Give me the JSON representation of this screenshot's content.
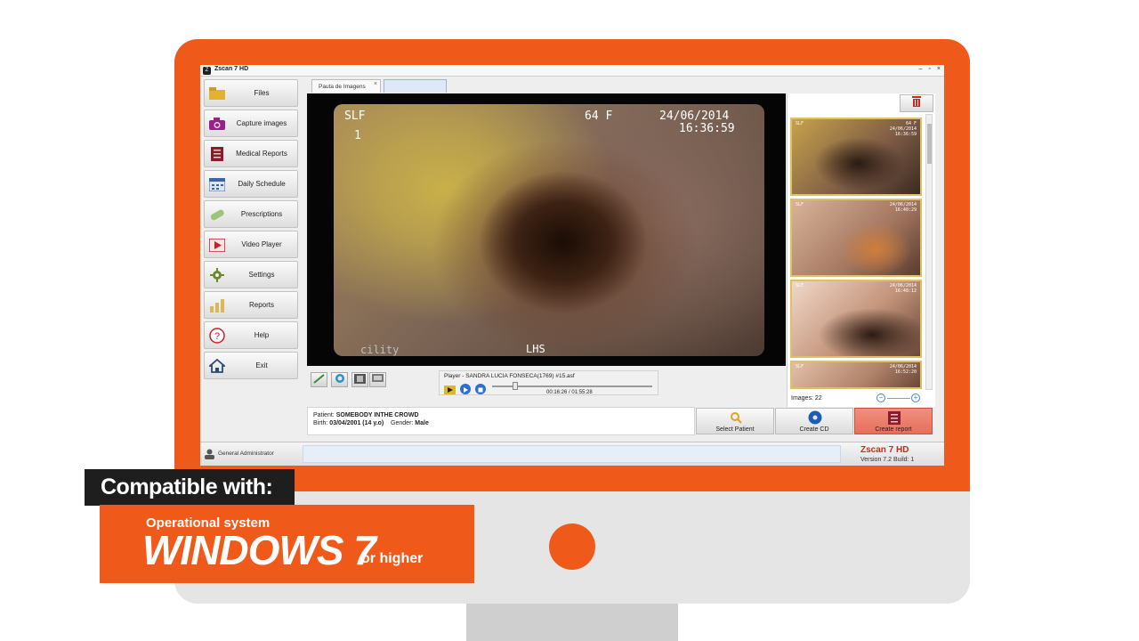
{
  "app": {
    "title": "Zscan 7 HD",
    "window_controls": [
      "–",
      "▫",
      "×"
    ]
  },
  "sidebar": {
    "items": [
      {
        "label": "Files",
        "icon": "folder-icon"
      },
      {
        "label": "Capture images",
        "icon": "camera-icon"
      },
      {
        "label": "Medical Reports",
        "icon": "report-book-icon"
      },
      {
        "label": "Daily Schedule",
        "icon": "calendar-icon"
      },
      {
        "label": "Prescriptions",
        "icon": "pill-icon"
      },
      {
        "label": "Video Player",
        "icon": "video-play-icon"
      },
      {
        "label": "Settings",
        "icon": "gear-icon"
      },
      {
        "label": "Reports",
        "icon": "bar-chart-icon"
      },
      {
        "label": "Help",
        "icon": "help-icon"
      },
      {
        "label": "Exit",
        "icon": "home-icon"
      }
    ]
  },
  "tabs": {
    "active_label": "Pauta de Imagens",
    "close_glyph": "×"
  },
  "video": {
    "osd_top_left": "SLF",
    "osd_index": "1",
    "osd_age_sex": "64  F",
    "osd_date": "24/06/2014",
    "osd_time": "16:36:59",
    "osd_bottom": "LHS",
    "osd_bottom_left": "cility"
  },
  "player": {
    "title": "Player - SANDRA LUCIA FONSECA(1769) #15.asf",
    "time": "00:16:26 / 01:55:28",
    "progress": 0.142
  },
  "patient": {
    "patient_label": "Patient:",
    "patient_name": "SOMEBODY INTHE CROWD",
    "birth_label": "Birth:",
    "birth_value": "03/04/2001 (14 y.o)",
    "gender_label": "Gender:",
    "gender_value": "Male"
  },
  "actions": {
    "select_patient": "Select Patient",
    "create_cd": "Create CD",
    "create_report": "Create report"
  },
  "thumbnails": {
    "images_label": "Images: 22",
    "items": [
      {
        "tl": "SLF",
        "tr": "64 F\n24/06/2014\n16:36:59"
      },
      {
        "tl": "SLF",
        "tr": "24/06/2014\n16:40:29"
      },
      {
        "tl": "SLF",
        "tr": "24/06/2014\n16:48:12"
      },
      {
        "tl": "SLF",
        "tr": "24/06/2014\n16:52:20"
      }
    ]
  },
  "statusbar": {
    "user": "General Administrator",
    "brand": "Zscan 7 HD",
    "version": "Version 7.2   Build: 1"
  },
  "caption": {
    "compatible": "Compatible with:",
    "os_label": "Operational system",
    "os_name": "WINDOWS 7",
    "os_suffix": "or higher"
  },
  "colors": {
    "accent_orange": "#ef5a1a",
    "brand_red": "#d9261c",
    "report_button": "#e5705c"
  }
}
